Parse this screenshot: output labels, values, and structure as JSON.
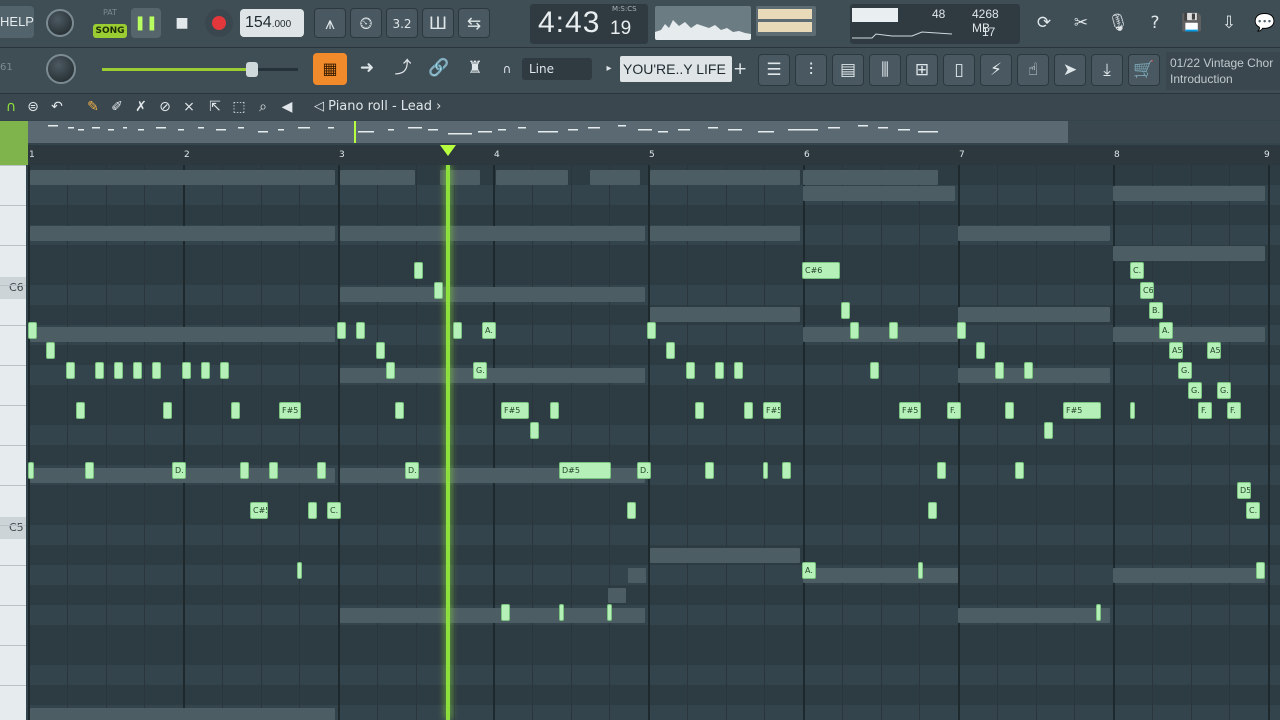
{
  "toolbar": {
    "help_label": "HELP",
    "pat_label": "PAT",
    "song_label": "SONG",
    "play_icon": "pause-icon",
    "tempo": "154",
    "tempo_decimals": ".000",
    "time_main": "4:43",
    "time_sub": "19",
    "time_format": "M:S:CS",
    "cpu_polyphony": "48",
    "memory": "4268 MB",
    "voices": "17",
    "snap_label": "Line",
    "pattern_name": "YOU'RE..Y LIFE",
    "hint_line1": "01/22  Vintage Chor",
    "hint_line2": "Introduction",
    "left_indicator": "61"
  },
  "piano_roll": {
    "title": "Piano roll - Lead",
    "key_labels": [
      "C6",
      "C5"
    ]
  },
  "ruler": {
    "bars": [
      "1",
      "2",
      "3",
      "4",
      "5",
      "6",
      "7",
      "8",
      "9"
    ]
  },
  "notes": [
    {
      "label": "C#6"
    },
    {
      "label": "A."
    },
    {
      "label": "G."
    },
    {
      "label": "F#5"
    },
    {
      "label": "F#5"
    },
    {
      "label": "F#5"
    },
    {
      "label": "F#5"
    },
    {
      "label": "F#5"
    },
    {
      "label": "D."
    },
    {
      "label": "D."
    },
    {
      "label": "D#5"
    },
    {
      "label": "D."
    },
    {
      "label": "C#5"
    },
    {
      "label": "C."
    },
    {
      "label": "A."
    },
    {
      "label": "C."
    },
    {
      "label": "C6"
    },
    {
      "label": "B."
    },
    {
      "label": "A."
    },
    {
      "label": "A5"
    },
    {
      "label": "A5"
    },
    {
      "label": "G."
    },
    {
      "label": "G."
    },
    {
      "label": "G."
    },
    {
      "label": "F."
    },
    {
      "label": "F."
    },
    {
      "label": "F."
    },
    {
      "label": "D5"
    },
    {
      "label": "C."
    }
  ],
  "colors": {
    "accent_green": "#9acd32",
    "note_fill": "#b5f0b8",
    "playhead": "#8ee03c",
    "active_tool": "#f08a2b",
    "record": "#e2383c"
  }
}
